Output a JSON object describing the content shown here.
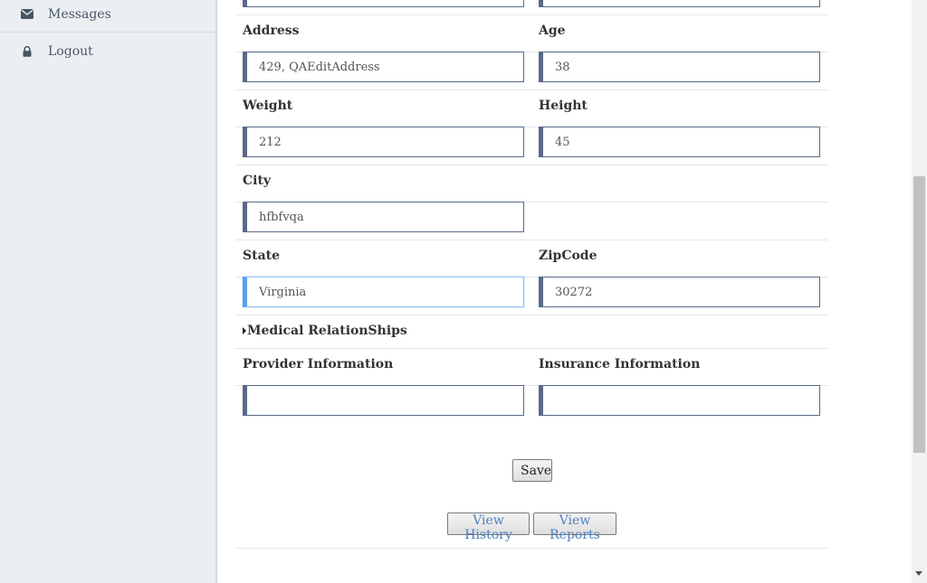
{
  "sidebar": {
    "items": [
      {
        "label": "Messages",
        "icon": "envelope-icon"
      },
      {
        "label": "Logout",
        "icon": "lock-icon"
      }
    ]
  },
  "form": {
    "address": {
      "label": "Address",
      "value": "429, QAEditAddress"
    },
    "age": {
      "label": "Age",
      "value": "38"
    },
    "weight": {
      "label": "Weight",
      "value": "212"
    },
    "height": {
      "label": "Height",
      "value": "45"
    },
    "city": {
      "label": "City",
      "value": "hfbfvqa"
    },
    "state": {
      "label": "State",
      "value": "Virginia"
    },
    "zipcode": {
      "label": "ZipCode",
      "value": "30272"
    },
    "medical_relationships": {
      "label": "Medical RelationShips"
    },
    "provider": {
      "label": "Provider Information",
      "value": ""
    },
    "insurance": {
      "label": "Insurance Information",
      "value": ""
    }
  },
  "buttons": {
    "save": "Save",
    "view_history": "View History",
    "view_reports": "View Reports"
  },
  "colors": {
    "input_border": "#59698a",
    "focus_border": "#5aa0e6",
    "link_button_text": "#4d7fbf",
    "sidebar_bg": "#eceff2"
  }
}
